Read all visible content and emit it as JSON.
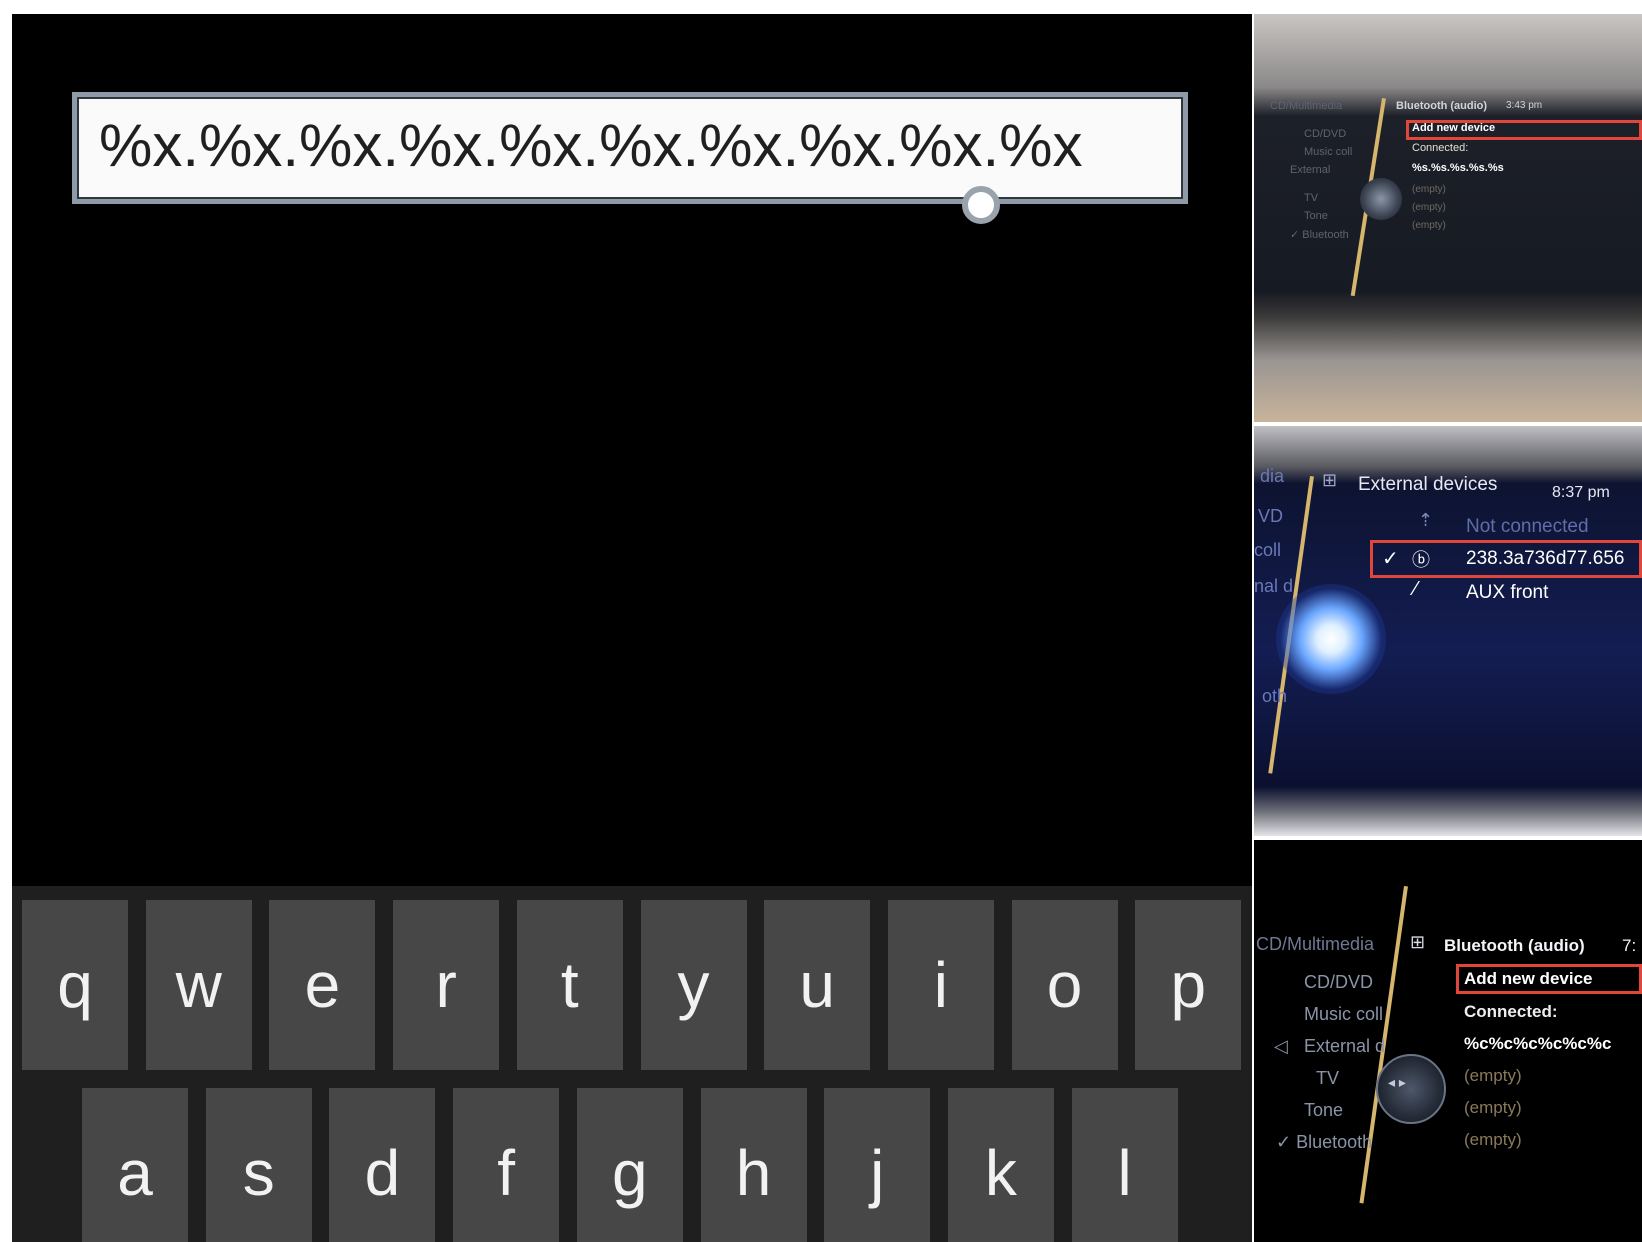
{
  "phone": {
    "input_value": "%x.%x.%x.%x.%x.%x.%x.%x.%x.%x",
    "keyboard": {
      "row1": [
        "q",
        "w",
        "e",
        "r",
        "t",
        "y",
        "u",
        "i",
        "o",
        "p"
      ],
      "row2": [
        "a",
        "s",
        "d",
        "f",
        "g",
        "h",
        "j",
        "k",
        "l"
      ]
    }
  },
  "panel_1": {
    "menu": [
      "CD/Multimedia",
      "CD/DVD",
      "Music coll",
      "External",
      "TV",
      "Tone",
      "✓ Bluetooth"
    ],
    "header": "Bluetooth (audio)",
    "time": "3:43 pm",
    "list": [
      "Add new device",
      "Connected:",
      "%s.%s.%s.%s.%s",
      "(empty)",
      "(empty)",
      "(empty)"
    ]
  },
  "panel_2": {
    "menu": [
      "dia",
      "VD",
      "coll",
      "nal d",
      "oth"
    ],
    "header": "External devices",
    "time": "8:37 pm",
    "list": [
      "Not connected",
      "238.3a736d77.656",
      "AUX front"
    ],
    "check": "✓"
  },
  "panel_3": {
    "menu": [
      "CD/Multimedia",
      "CD/DVD",
      "Music coll",
      "External d",
      "TV",
      "Tone",
      "✓ Bluetooth"
    ],
    "header": "Bluetooth (audio)",
    "time": "7:",
    "list": [
      "Add new device",
      "Connected:",
      "%c%c%c%c%c%c",
      "(empty)",
      "(empty)",
      "(empty)"
    ]
  }
}
